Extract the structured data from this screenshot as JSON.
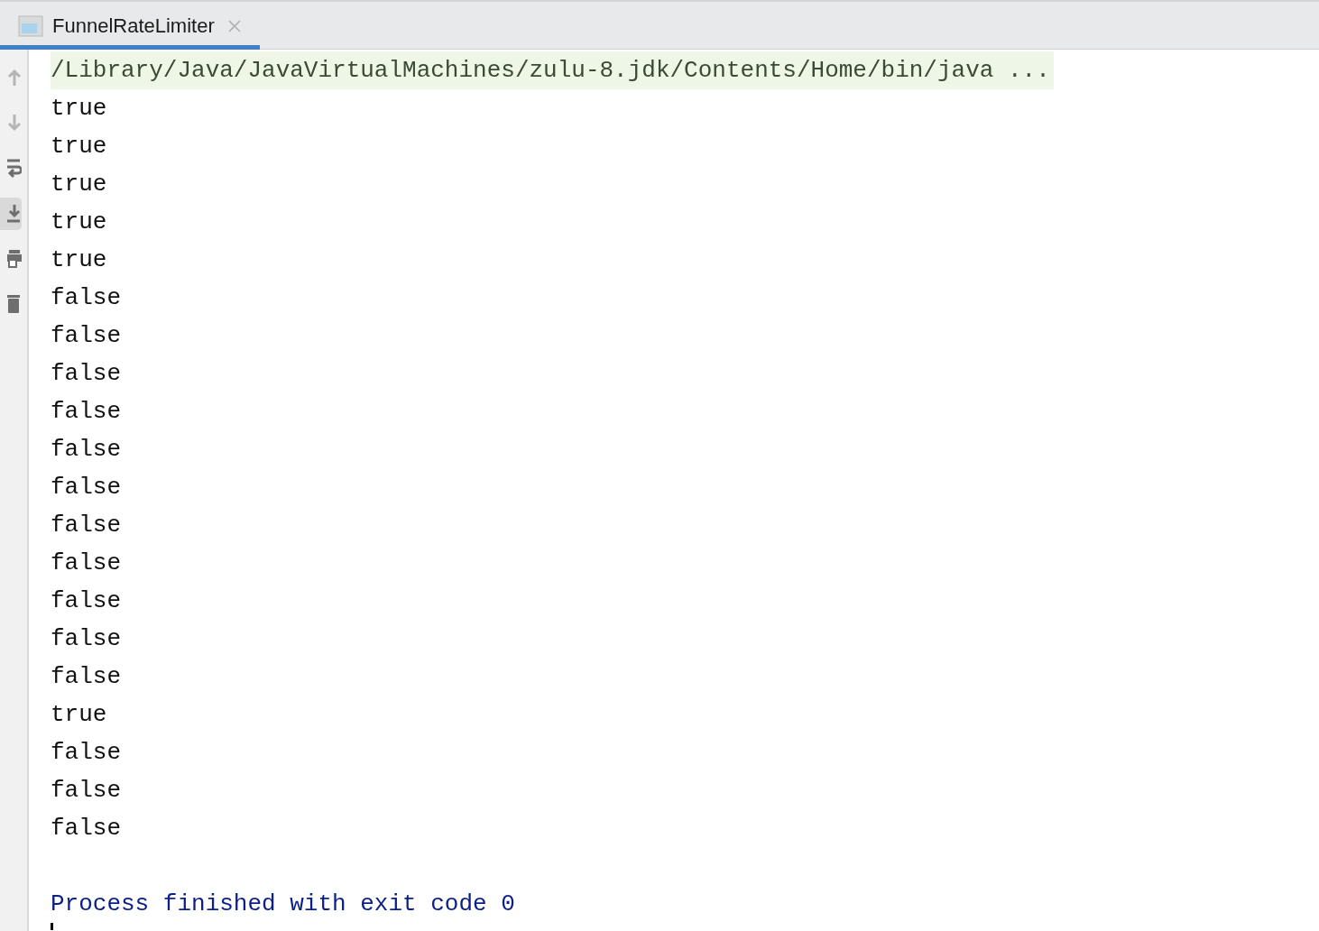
{
  "tab": {
    "title": "FunnelRateLimiter",
    "selected": true
  },
  "toolbar": [
    {
      "kind": "up",
      "disabled": true,
      "on": false
    },
    {
      "kind": "down",
      "disabled": true,
      "on": false
    },
    {
      "kind": "wrap",
      "disabled": false,
      "on": false
    },
    {
      "kind": "scroll-end",
      "disabled": false,
      "on": true
    },
    {
      "kind": "print",
      "disabled": false,
      "on": false
    },
    {
      "kind": "trash",
      "disabled": false,
      "on": false
    }
  ],
  "console": [
    {
      "kind": "command",
      "text": "/Library/Java/JavaVirtualMachines/zulu-8.jdk/Contents/Home/bin/java ..."
    },
    {
      "kind": "output",
      "text": "true"
    },
    {
      "kind": "output",
      "text": "true"
    },
    {
      "kind": "output",
      "text": "true"
    },
    {
      "kind": "output",
      "text": "true"
    },
    {
      "kind": "output",
      "text": "true"
    },
    {
      "kind": "output",
      "text": "false"
    },
    {
      "kind": "output",
      "text": "false"
    },
    {
      "kind": "output",
      "text": "false"
    },
    {
      "kind": "output",
      "text": "false"
    },
    {
      "kind": "output",
      "text": "false"
    },
    {
      "kind": "output",
      "text": "false"
    },
    {
      "kind": "output",
      "text": "false"
    },
    {
      "kind": "output",
      "text": "false"
    },
    {
      "kind": "output",
      "text": "false"
    },
    {
      "kind": "output",
      "text": "false"
    },
    {
      "kind": "output",
      "text": "false"
    },
    {
      "kind": "output",
      "text": "true"
    },
    {
      "kind": "output",
      "text": "false"
    },
    {
      "kind": "output",
      "text": "false"
    },
    {
      "kind": "output",
      "text": "false"
    },
    {
      "kind": "exit",
      "text": "Process finished with exit code 0"
    }
  ]
}
